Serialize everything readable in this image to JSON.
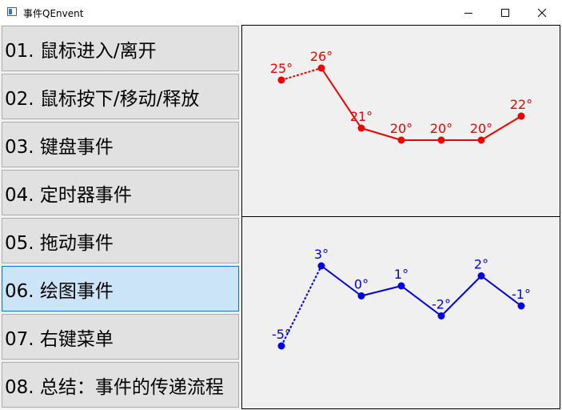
{
  "window": {
    "title": "事件QEnvent",
    "icon": "app-window-icon",
    "controls": [
      "minimize-icon",
      "maximize-icon",
      "close-icon"
    ]
  },
  "nav": {
    "items": [
      {
        "label": "01. 鼠标进入/离开",
        "active": false
      },
      {
        "label": "02. 鼠标按下/移动/释放",
        "active": false
      },
      {
        "label": "03. 键盘事件",
        "active": false
      },
      {
        "label": "04. 定时器事件",
        "active": false
      },
      {
        "label": "05. 拖动事件",
        "active": false
      },
      {
        "label": "06. 绘图事件",
        "active": true
      },
      {
        "label": "07. 右键菜单",
        "active": false
      },
      {
        "label": "08. 总结：事件的传递流程",
        "active": false
      }
    ]
  },
  "chart_data": [
    {
      "type": "line",
      "title": "",
      "color": "#ee0000",
      "x": [
        1,
        2,
        3,
        4,
        5,
        6,
        7
      ],
      "series": [
        {
          "values": [
            25,
            26,
            21,
            20,
            20,
            20,
            22
          ],
          "labels": [
            "25°",
            "26°",
            "21°",
            "20°",
            "20°",
            "20°",
            "22°"
          ],
          "dashed_segments": [
            0
          ]
        }
      ],
      "ylim": [
        18,
        28
      ],
      "grid": false
    },
    {
      "type": "line",
      "title": "",
      "color": "#0000dd",
      "x": [
        1,
        2,
        3,
        4,
        5,
        6,
        7
      ],
      "series": [
        {
          "values": [
            -5,
            3,
            0,
            1,
            -2,
            2,
            -1
          ],
          "labels": [
            "-5°",
            "3°",
            "0°",
            "1°",
            "-2°",
            "2°",
            "-1°"
          ],
          "dashed_segments": [
            0
          ]
        }
      ],
      "ylim": [
        -7,
        6
      ],
      "grid": false
    }
  ]
}
